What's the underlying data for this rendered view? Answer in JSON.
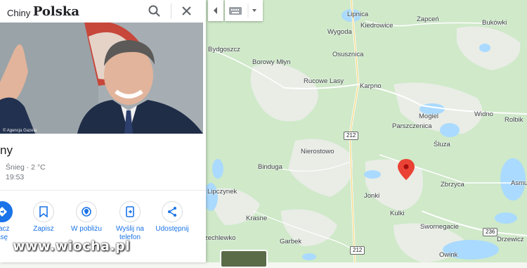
{
  "search": {
    "query_prefix": "Chiny",
    "query_word": "Polska"
  },
  "photo": {
    "credit": "© Agencja Gazeta"
  },
  "place": {
    "name": "ny",
    "weather": "Śnieg · 2 °C",
    "time": "19:53"
  },
  "actions": [
    {
      "label_line1": "nacz",
      "label_line2": "asę",
      "icon": "directions-icon"
    },
    {
      "label_line1": "Zapisz",
      "label_line2": "",
      "icon": "bookmark-icon"
    },
    {
      "label_line1": "W pobliżu",
      "label_line2": "",
      "icon": "nearby-icon"
    },
    {
      "label_line1": "Wyślij na",
      "label_line2": "telefon",
      "icon": "send-to-phone-icon"
    },
    {
      "label_line1": "Udostępnij",
      "label_line2": "",
      "icon": "share-icon"
    }
  ],
  "map": {
    "labels": {
      "lipnica": "Lipnica",
      "kiedrowice": "Kiedrowice",
      "zapcen": "Zapceń",
      "bukowki": "Bukówki",
      "wygoda": "Wygoda",
      "bydgoszcz": "Bydgoszcz",
      "osusznica": "Osusznica",
      "borowy_mlyn": "Borowy Młyn",
      "rucowe_lasy": "Rucowe Lasy",
      "karpno": "Karpno",
      "mogiel": "Mogiel",
      "widno": "Widno",
      "rolbik": "Rolbik",
      "parszczenica": "Parszczenica",
      "nierostowo": "Nierostowo",
      "sluza": "Śluza",
      "binduga": "Binduga",
      "zbrzyca": "Zbrzyca",
      "asmu": "Asmu",
      "lipczynek": "Lipczynek",
      "jonki": "Jonki",
      "krasne": "Krasne",
      "kulki": "Kulki",
      "swornegacie": "Swornegacie",
      "zechlewko": "zechlewko",
      "garbek": "Garbek",
      "drzewicz": "Drzewicz",
      "owink": "Owink",
      "rucowe": ""
    },
    "roads": {
      "r212a": "212",
      "r212b": "212",
      "r236": "236"
    }
  },
  "watermark": "www.wiocha.pl",
  "colors": {
    "accent": "#1a73e8",
    "marker": "#ea4335",
    "map_bg": "#f4f6f1",
    "forest": "#c8e6c9",
    "water": "#aadaff"
  }
}
